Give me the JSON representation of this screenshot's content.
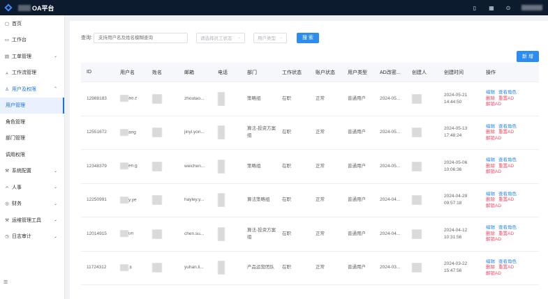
{
  "app": {
    "title": "OA平台"
  },
  "topbar": {
    "icons": [
      "mobile-icon",
      "grid-icon",
      "help-icon"
    ]
  },
  "sidebar": {
    "items": [
      {
        "label": "首页",
        "icon": "home-icon"
      },
      {
        "label": "工作台",
        "icon": "workbench-icon"
      },
      {
        "label": "工单管理",
        "icon": "ticket-icon",
        "chevron": "down"
      },
      {
        "label": "工作流管理",
        "icon": "workflow-icon"
      },
      {
        "label": "用户及权限",
        "icon": "user-icon",
        "chevron": "up"
      }
    ],
    "subitems": [
      {
        "label": "用户管理"
      },
      {
        "label": "角色管理"
      },
      {
        "label": "部门管理"
      },
      {
        "label": "调用权限"
      }
    ],
    "items2": [
      {
        "label": "系统配置",
        "icon": "wrench-icon"
      },
      {
        "label": "人事",
        "icon": "people-icon"
      },
      {
        "label": "财务",
        "icon": "finance-icon"
      },
      {
        "label": "运维管理工具",
        "icon": "tools-icon"
      },
      {
        "label": "日志审计",
        "icon": "log-icon"
      }
    ]
  },
  "search": {
    "label": "查询:",
    "placeholder": "支持用户名及姓名模糊查询",
    "work_status_placeholder": "请选择员工状态",
    "user_type_placeholder": "用户类型",
    "search_button": "搜 索"
  },
  "add_button": "新 增",
  "table": {
    "headers": [
      "ID",
      "用户名",
      "姓名",
      "邮箱",
      "电话",
      "部门",
      "工作状态",
      "账户状态",
      "用户类型",
      "AD改密...",
      "创建人",
      "创建时间",
      "操作"
    ],
    "rows": [
      {
        "id": "12988183",
        "username": "ao.z",
        "email": "zhoutao...",
        "dept": "策略组",
        "work_status": "在职",
        "account_status": "正常",
        "user_type": "普通用户",
        "ad": "2024-05...",
        "created_date": "2024-05-21",
        "created_time": "14:44:50"
      },
      {
        "id": "12551672",
        "username": "ang",
        "email": "jinyi.yon...",
        "dept": "算法-投资方案组",
        "work_status": "在职",
        "account_status": "正常",
        "user_type": "普通用户",
        "ad": "2024-05...",
        "created_date": "2024-05-13",
        "created_time": "17:48:24"
      },
      {
        "id": "12348379",
        "username": "en.g",
        "email": "weichen...",
        "dept": "策略组",
        "work_status": "在职",
        "account_status": "正常",
        "user_type": "普通用户",
        "ad": "2024-05...",
        "created_date": "2024-05-06",
        "created_time": "10:06:36"
      },
      {
        "id": "12250991",
        "username": "y.ye",
        "email": "hayley.y...",
        "dept": "算法策略组",
        "work_status": "在职",
        "account_status": "正常",
        "user_type": "普通用户",
        "ad": "2024-04...",
        "created_date": "2024-04-29",
        "created_time": "09:57:18"
      },
      {
        "id": "12014915",
        "username": "un",
        "email": "chen.su...",
        "dept": "算法-投资方案组",
        "work_status": "在职",
        "account_status": "正常",
        "user_type": "普通用户",
        "ad": "2024-04...",
        "created_date": "2024-04-12",
        "created_time": "10:31:56"
      },
      {
        "id": "11724312",
        "username": ".li",
        "email": "yuhan.li...",
        "dept": "产品运营团队",
        "work_status": "在职",
        "account_status": "正常",
        "user_type": "普通用户",
        "ad": "2024-03...",
        "created_date": "2024-03-22",
        "created_time": "15:47:56"
      }
    ],
    "ops": {
      "edit": "编辑",
      "view_role": "查看角色",
      "delete": "删除",
      "reset_ad": "重置AD",
      "unlock_ad": "解锁AD"
    }
  }
}
